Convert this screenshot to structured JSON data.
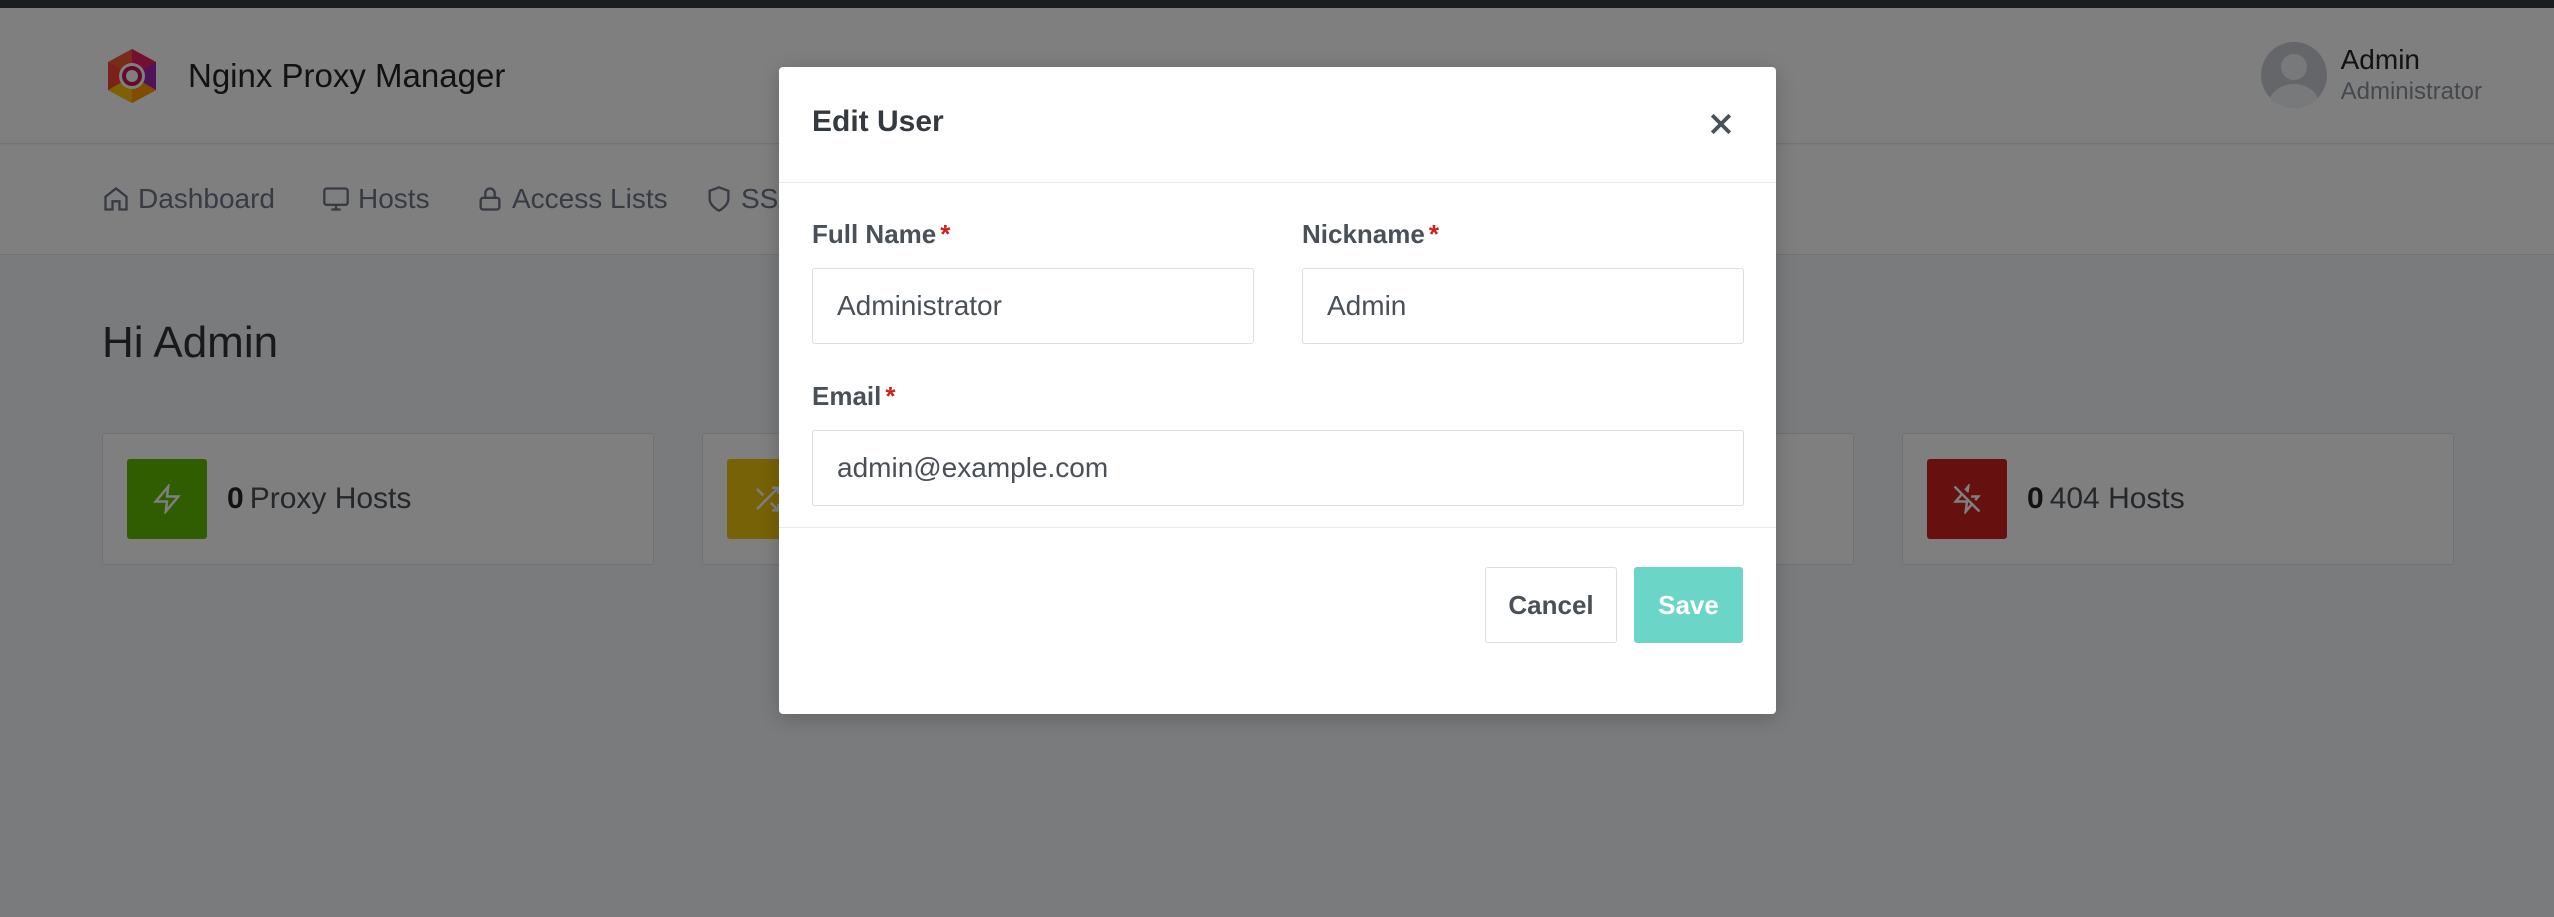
{
  "app": {
    "name": "Nginx Proxy Manager"
  },
  "user": {
    "name": "Admin",
    "role": "Administrator"
  },
  "nav": {
    "items": [
      {
        "label": "Dashboard",
        "icon": "home-icon"
      },
      {
        "label": "Hosts",
        "icon": "monitor-icon"
      },
      {
        "label": "Access Lists",
        "icon": "lock-icon"
      },
      {
        "label": "SSL",
        "icon": "shield-icon"
      }
    ]
  },
  "page": {
    "greeting": "Hi Admin"
  },
  "cards": [
    {
      "count": "0",
      "label": "Proxy Hosts",
      "color": "#5eba00",
      "icon": "zap-icon"
    },
    {
      "count": "",
      "label": "",
      "color": "#f1c40f",
      "icon": "shuffle-icon"
    },
    {
      "count": "",
      "label": "",
      "color": "#ffffff",
      "icon": ""
    },
    {
      "count": "0",
      "label": "404 Hosts",
      "color": "#cd201f",
      "icon": "zap-off-icon"
    }
  ],
  "modal": {
    "title": "Edit User",
    "fields": {
      "full_name": {
        "label": "Full Name",
        "required_mark": "*",
        "value": "Administrator"
      },
      "nickname": {
        "label": "Nickname",
        "required_mark": "*",
        "value": "Admin"
      },
      "email": {
        "label": "Email",
        "required_mark": "*",
        "value": "admin@example.com"
      }
    },
    "cancel_label": "Cancel",
    "save_label": "Save"
  }
}
